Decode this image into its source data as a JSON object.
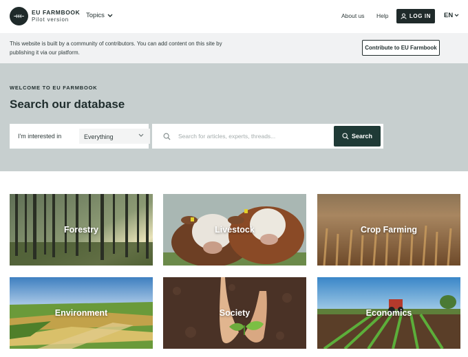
{
  "header": {
    "logo_name": "EU FARMBOOK",
    "logo_sub": "Pilot version",
    "topics_label": "Topics",
    "about_label": "About us",
    "help_label": "Help",
    "login_label": "LOG IN",
    "lang_label": "EN"
  },
  "notice": {
    "text": "This website is built by a community of contributors. You can add content on this site by publishing it via our platform.",
    "contribute_label": "Contribute to EU Farmbook"
  },
  "hero": {
    "eyebrow": "WELCOME TO EU FARMBOOK",
    "title": "Search our database",
    "filter_label": "I'm interested in",
    "filter_value": "Everything",
    "search_placeholder": "Search for articles, experts, threads...",
    "search_button": "Search"
  },
  "categories": [
    {
      "label": "Forestry"
    },
    {
      "label": "Livestock"
    },
    {
      "label": "Crop Farming"
    },
    {
      "label": "Environment"
    },
    {
      "label": "Society"
    },
    {
      "label": "Economics"
    }
  ],
  "colors": {
    "dark": "#1f2a2a",
    "hero_bg": "#c7cfcf",
    "notice_bg": "#f1f2f3",
    "search_button": "#1f3a36"
  }
}
